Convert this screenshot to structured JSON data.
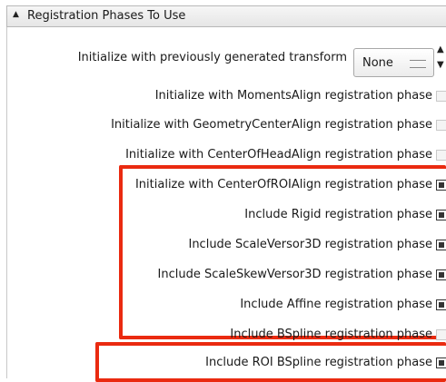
{
  "section": {
    "title": "Registration Phases To Use",
    "collapse_icon": "caret-up-icon"
  },
  "transform": {
    "label": "Initialize with previously generated transform",
    "value": "None",
    "spinner_icons": [
      "up-arrow-icon",
      "down-arrow-icon"
    ]
  },
  "phases": [
    {
      "label": "Initialize with MomentsAlign registration phase",
      "checked": false
    },
    {
      "label": "Initialize with GeometryCenterAlign registration phase",
      "checked": false
    },
    {
      "label": "Initialize with CenterOfHeadAlign registration phase",
      "checked": false
    },
    {
      "label": "Initialize with CenterOfROIAlign registration phase",
      "checked": true
    },
    {
      "label": "Include Rigid registration phase",
      "checked": true
    },
    {
      "label": "Include ScaleVersor3D registration phase",
      "checked": true
    },
    {
      "label": "Include ScaleSkewVersor3D registration phase",
      "checked": true
    },
    {
      "label": "Include Affine registration phase",
      "checked": true
    },
    {
      "label": "Include BSpline registration phase",
      "checked": false
    },
    {
      "label": "Include ROI BSpline registration phase",
      "checked": true
    }
  ],
  "highlight_color": "#ea2a10"
}
